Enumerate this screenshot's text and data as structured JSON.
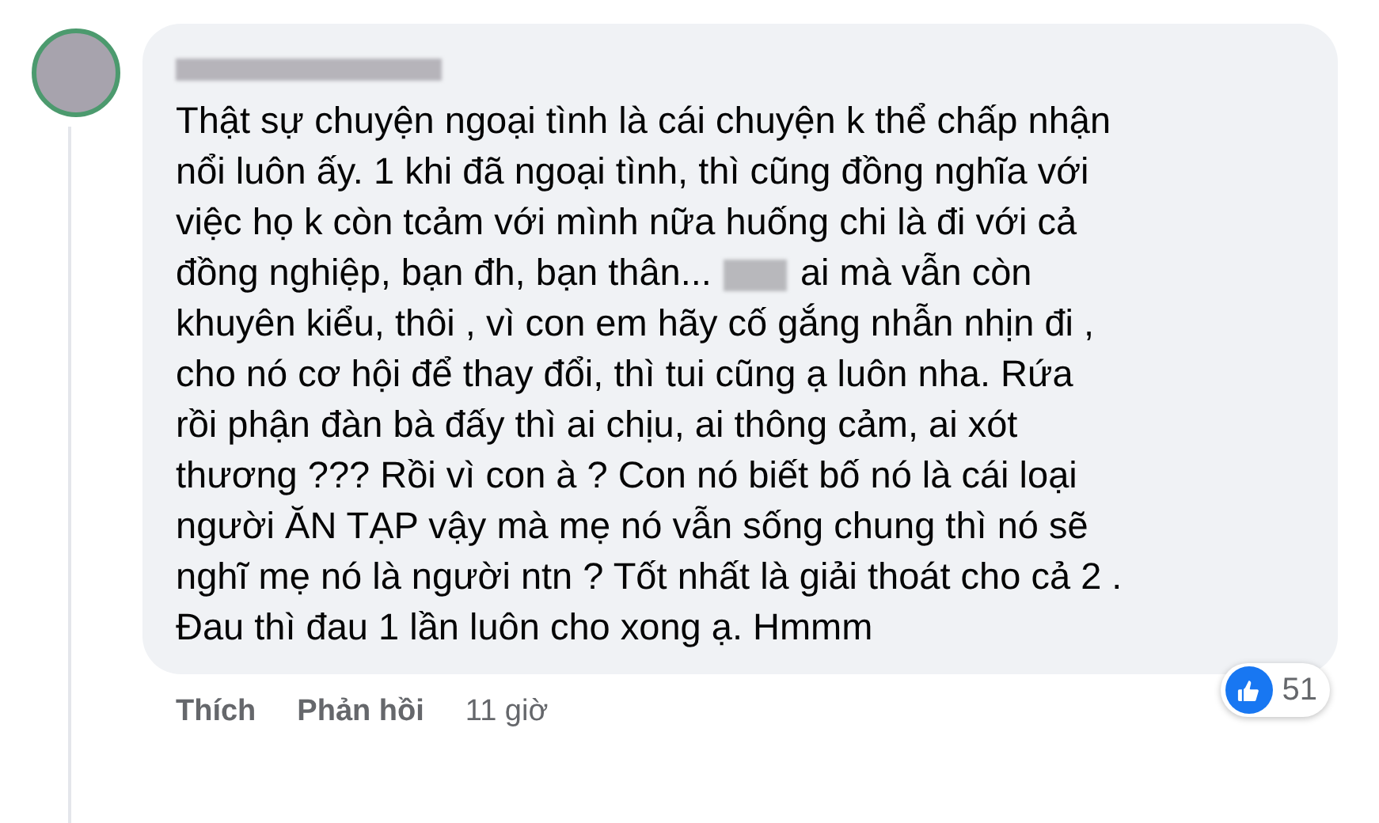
{
  "comment": {
    "lines": [
      [
        "Thật sự chuyện ngoại tình là cái chuyện k thể chấp nhận"
      ],
      [
        "nổi luôn ấy. 1 khi đã ngoại tình, thì cũng đồng nghĩa với"
      ],
      [
        "việc họ k còn tcảm với mình nữa huống chi là đi với cả"
      ],
      [
        "đồng nghiệp, bạn đh, bạn thân...",
        "ai mà vẫn còn"
      ],
      [
        "khuyên kiểu, thôi , vì con em hãy cố gắng nhẫn nhịn đi ,"
      ],
      [
        "cho nó cơ hội để thay đổi, thì tui cũng ạ luôn nha. Rứa"
      ],
      [
        "rồi phận đàn bà đấy thì ai chịu, ai thông cảm, ai xót"
      ],
      [
        "thương ??? Rồi vì con à ? Con nó biết bố nó là cái loại"
      ],
      [
        "người ĂN TẠP vậy mà mẹ nó vẫn sống chung thì nó sẽ"
      ],
      [
        "nghĩ mẹ nó là người ntn ? Tốt nhất là giải thoát cho cả 2 ."
      ],
      [
        "Đau thì đau 1 lần luôn cho xong ạ. Hmmm"
      ]
    ],
    "reaction_count": "51",
    "actions": [
      {
        "label": "Thích"
      },
      {
        "label": "Phản hồi"
      }
    ],
    "time": "11 giờ"
  }
}
